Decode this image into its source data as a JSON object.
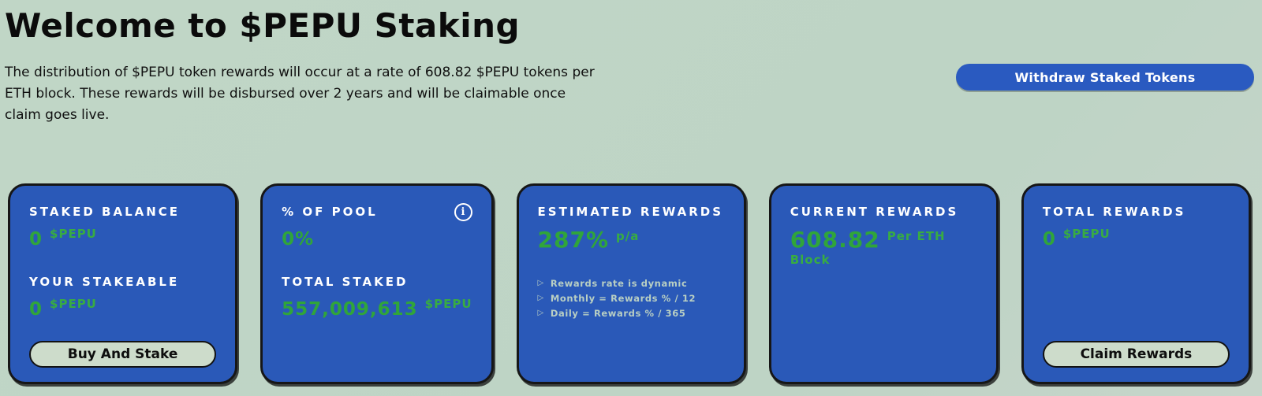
{
  "page": {
    "title": "Welcome to $PEPU Staking",
    "description": "The distribution of $PEPU token rewards will occur at a rate of 608.82 $PEPU tokens per ETH block. These rewards will be disbursed over 2 years and will be claimable once claim goes live.",
    "withdraw_button_label": "Withdraw Staked Tokens"
  },
  "colors": {
    "background": "#bed4c5",
    "card_blue": "#2a59b8",
    "accent_green": "#30a53a",
    "muted_note_text": "#b9cfc3",
    "pill_button_sage": "#cddccb"
  },
  "cards": {
    "staked_balance": {
      "label1": "STAKED BALANCE",
      "value1": "0",
      "unit1": "$PEPU",
      "label2": "YOUR STAKEABLE",
      "value2": "0",
      "unit2": "$PEPU",
      "button_label": "Buy And Stake"
    },
    "pool": {
      "label1": "% OF POOL",
      "value1": "0%",
      "info_icon_glyph": "i",
      "label2": "TOTAL STAKED",
      "value2": "557,009,613",
      "unit2": "$PEPU"
    },
    "estimated_rewards": {
      "label": "ESTIMATED REWARDS",
      "value": "287%",
      "unit": "p/a",
      "bullet_glyph": "▷",
      "notes": [
        "Rewards rate is dynamic",
        "Monthly = Rewards % / 12",
        "Daily = Rewards % / 365"
      ]
    },
    "current_rewards": {
      "label": "CURRENT REWARDS",
      "value": "608.82",
      "unit": "Per ETH Block"
    },
    "total_rewards": {
      "label": "TOTAL REWARDS",
      "value": "0",
      "unit": "$PEPU",
      "button_label": "Claim Rewards"
    }
  }
}
